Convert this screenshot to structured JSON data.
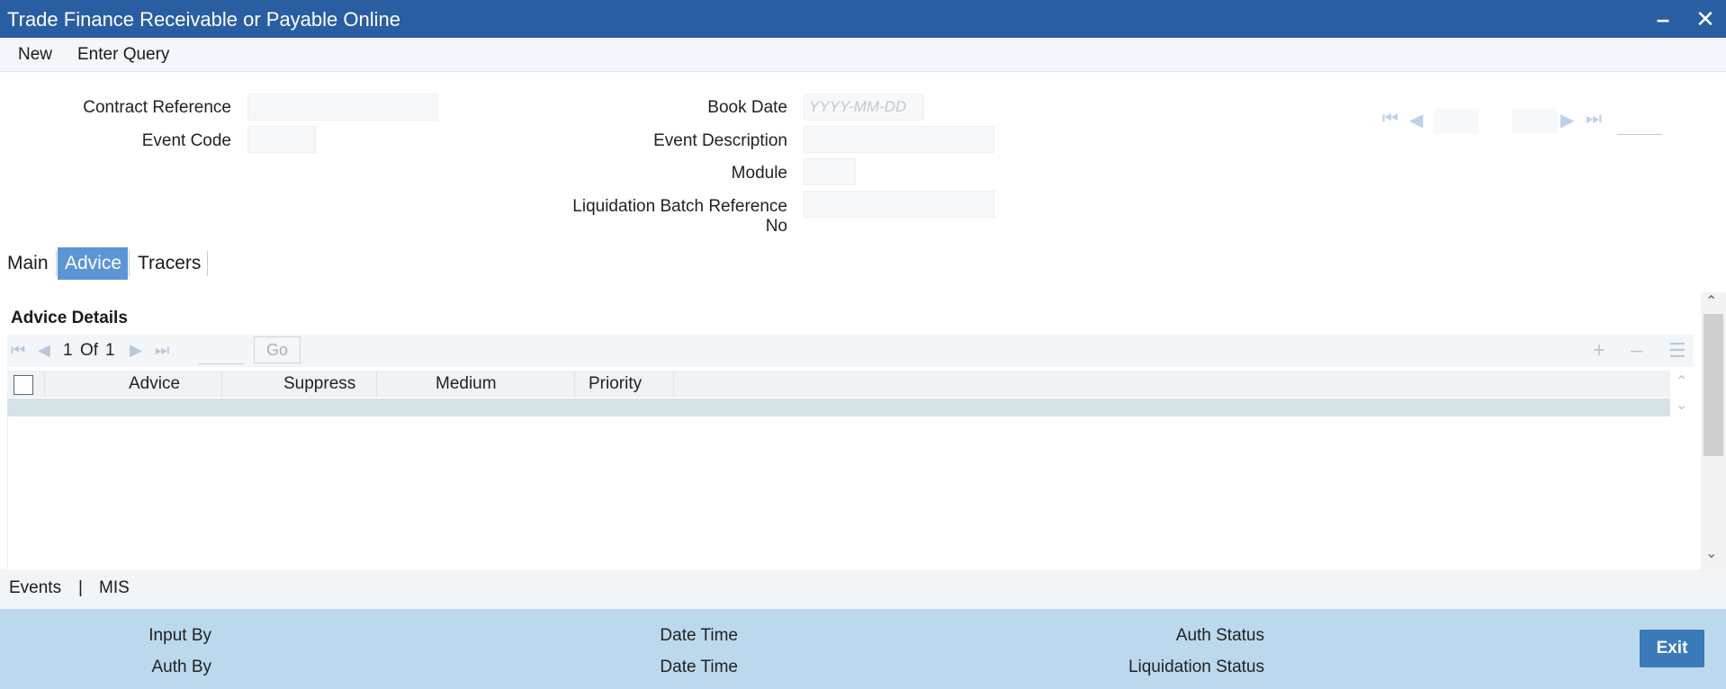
{
  "window": {
    "title": "Trade Finance Receivable or Payable Online"
  },
  "toolbar": {
    "new_label": "New",
    "enter_query_label": "Enter Query"
  },
  "header": {
    "contract_reference_label": "Contract Reference",
    "event_code_label": "Event Code",
    "book_date_label": "Book Date",
    "book_date_placeholder": "YYYY-MM-DD",
    "event_description_label": "Event Description",
    "module_label": "Module",
    "liquidation_batch_label_line1": "Liquidation Batch Reference",
    "liquidation_batch_label_line2": "No"
  },
  "tabs": [
    {
      "label": "Main",
      "active": false
    },
    {
      "label": "Advice",
      "active": true
    },
    {
      "label": "Tracers",
      "active": false
    }
  ],
  "advice": {
    "section_title": "Advice Details",
    "pager": {
      "current": "1",
      "of_label": "Of",
      "total": "1",
      "go_label": "Go"
    },
    "columns": [
      "Advice",
      "Suppress",
      "Medium",
      "Priority"
    ]
  },
  "bottom_links": {
    "events_label": "Events",
    "separator": "|",
    "mis_label": "MIS"
  },
  "footer": {
    "input_by_label": "Input By",
    "date_time_label_1": "Date Time",
    "auth_status_label": "Auth Status",
    "auth_by_label": "Auth By",
    "date_time_label_2": "Date Time",
    "liquidation_status_label": "Liquidation Status",
    "exit_label": "Exit"
  },
  "colors": {
    "titlebar": "#2a5ea2",
    "active_tab": "#5b95d6",
    "footer": "#bcd8ec",
    "exit_button": "#3a7ab8"
  }
}
